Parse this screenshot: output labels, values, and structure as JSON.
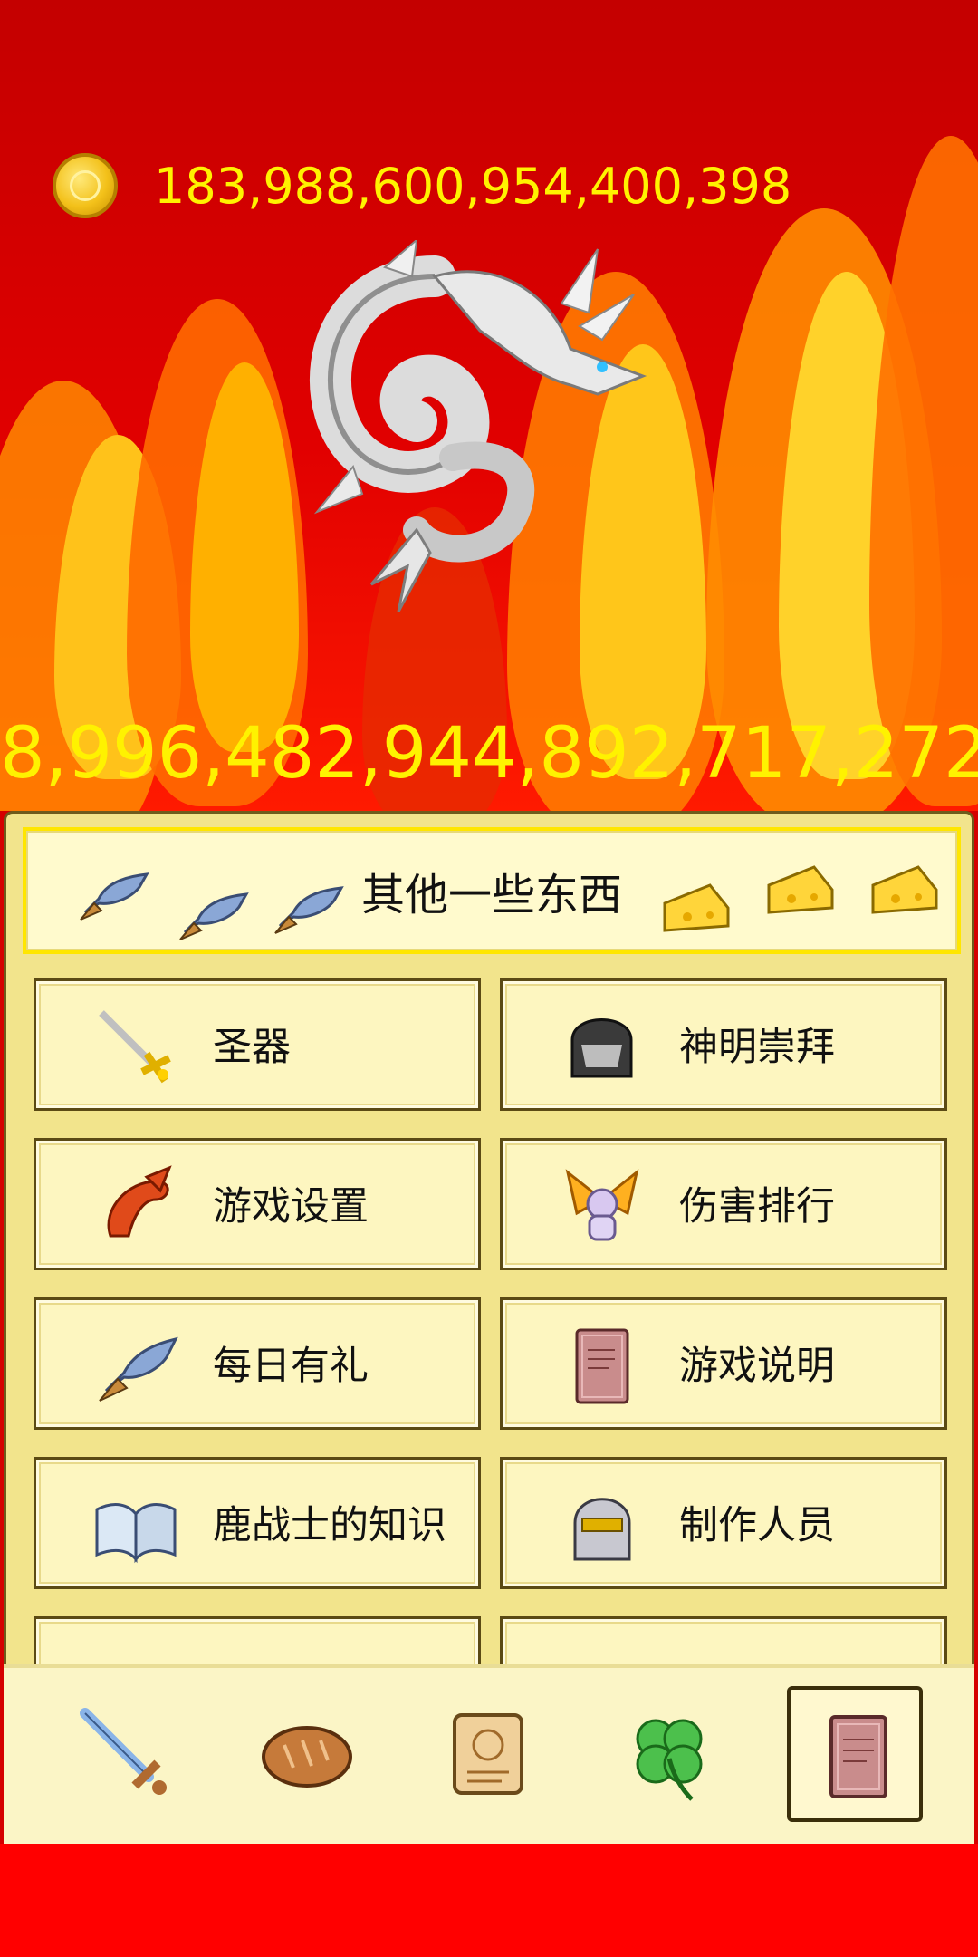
{
  "currency": {
    "icon": "gold-coin-icon",
    "amount": "183,988,600,954,400,398"
  },
  "boss": {
    "name_icon": "white-dragon-sprite",
    "damage": "8,996,482,944,892,717,272"
  },
  "panel": {
    "header_title": "其他一些东西",
    "menu": [
      {
        "label": "圣器",
        "icon": "holy-sword-icon"
      },
      {
        "label": "神明崇拜",
        "icon": "dark-helmet-icon"
      },
      {
        "label": "游戏设置",
        "icon": "lobster-claw-icon"
      },
      {
        "label": "伤害排行",
        "icon": "winged-angel-icon"
      },
      {
        "label": "每日有礼",
        "icon": "fish-icon"
      },
      {
        "label": "游戏说明",
        "icon": "book-icon"
      },
      {
        "label": "鹿战士的知识",
        "icon": "open-book-icon"
      },
      {
        "label": "制作人员",
        "icon": "knight-helmet-icon"
      }
    ]
  },
  "bottom_nav": [
    {
      "icon": "sword-icon",
      "active": false
    },
    {
      "icon": "bread-icon",
      "active": false
    },
    {
      "icon": "scroll-icon",
      "active": false
    },
    {
      "icon": "clover-icon",
      "active": false
    },
    {
      "icon": "book-icon",
      "active": true
    }
  ],
  "colors": {
    "number_yellow": "#fff200",
    "panel_bg": "#f2e48c",
    "button_bg": "#fdf6c0",
    "header_border": "#ffe600"
  }
}
